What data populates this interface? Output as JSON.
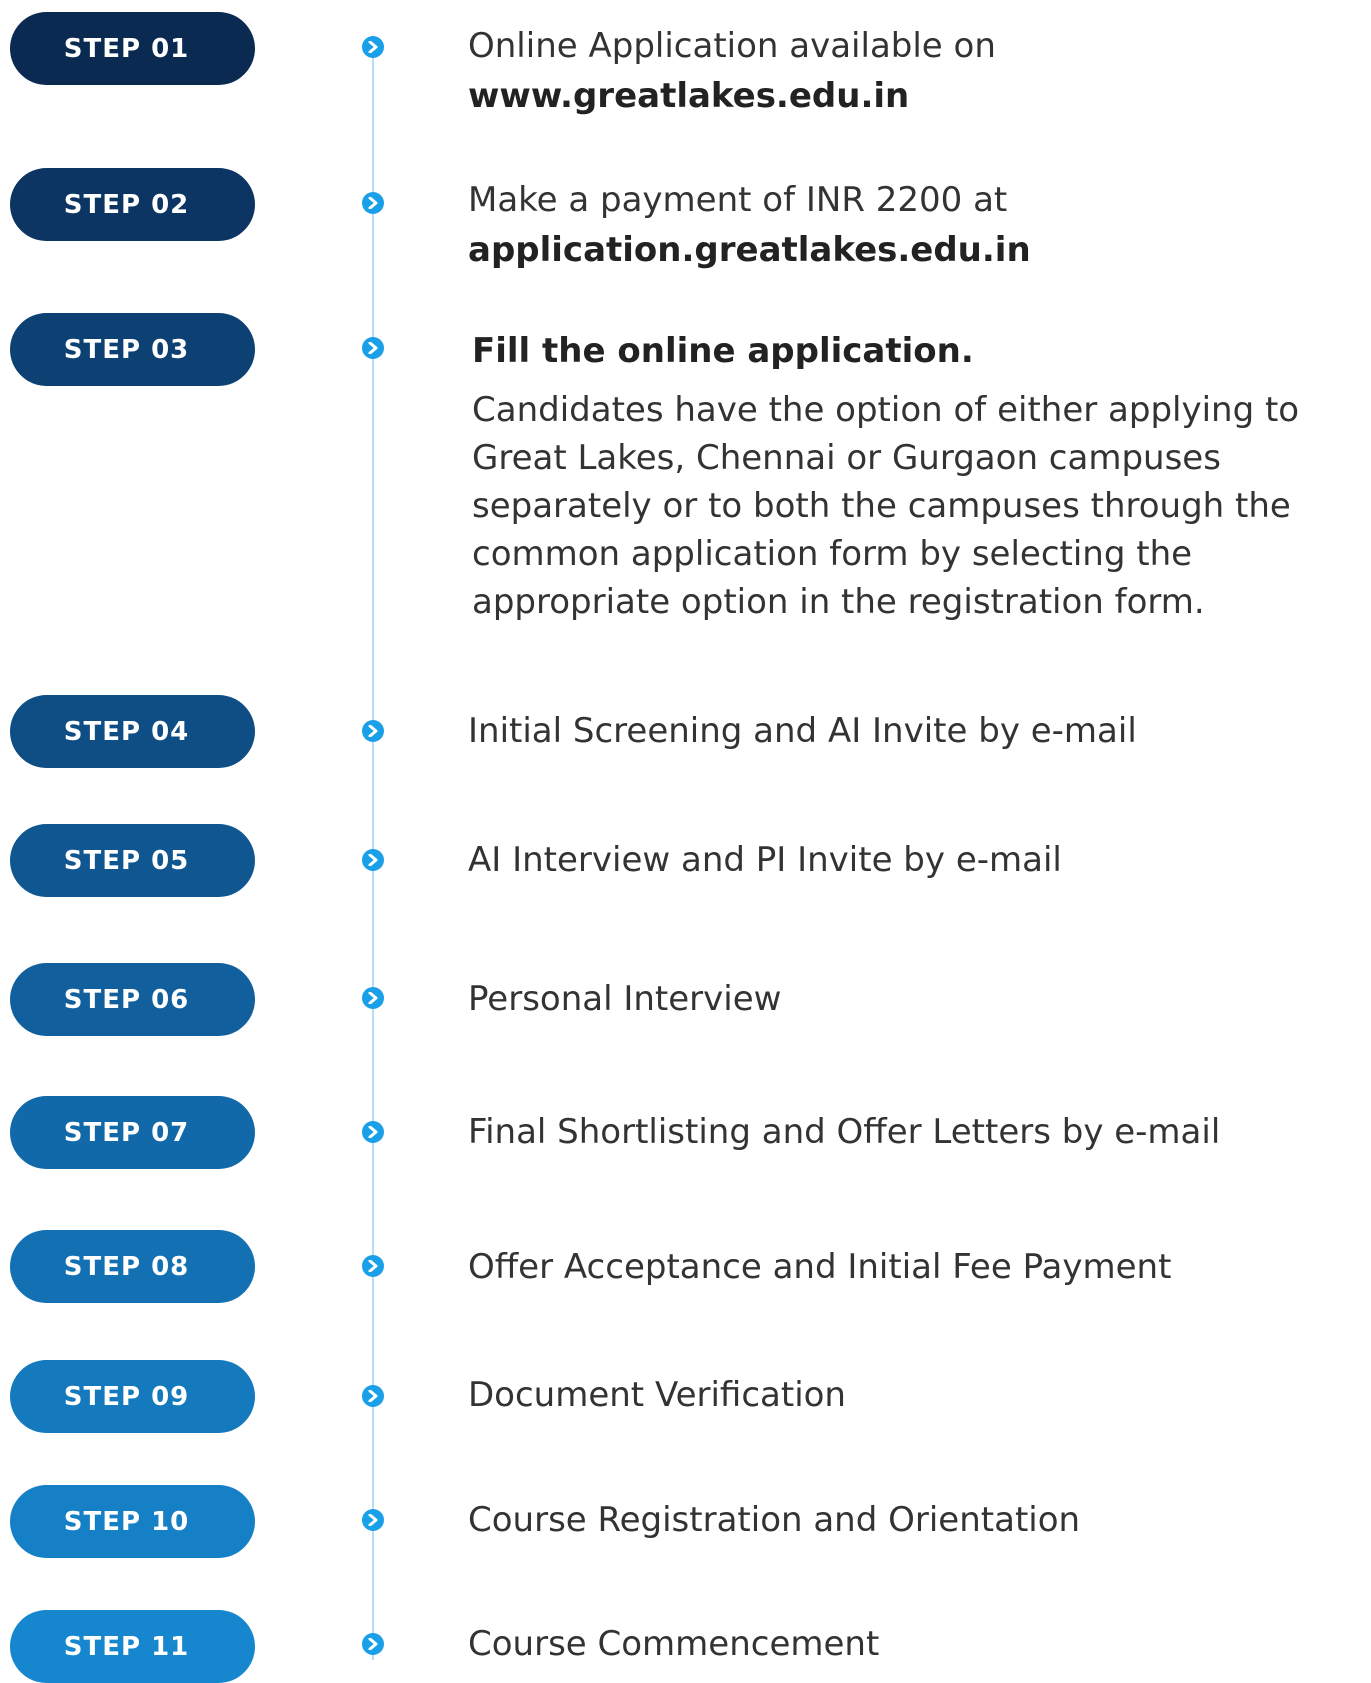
{
  "steps": [
    {
      "label": "STEP 01",
      "text": "Online Application available on",
      "link": "www.greatlakes.edu.in",
      "color": "#0a2a52"
    },
    {
      "label": "STEP 02",
      "text": "Make a payment of INR 2200 at",
      "link": "application.greatlakes.edu.in",
      "color": "#0c3563"
    },
    {
      "label": "STEP 03",
      "title": "Fill the online application.",
      "body": "Candidates have the option of either applying to\nGreat Lakes, Chennai or Gurgaon campuses\nseparately or to both the campuses through the\ncommon application form by selecting the\nappropriate option in the registration form.",
      "color": "#0e4173"
    },
    {
      "label": "STEP 04",
      "text": "Initial Screening and AI Invite by e-mail",
      "color": "#0f4d85"
    },
    {
      "label": "STEP 05",
      "text": "AI Interview and PI Invite by e-mail",
      "color": "#105791"
    },
    {
      "label": "STEP 06",
      "text": "Personal Interview",
      "color": "#11609d"
    },
    {
      "label": "STEP 07",
      "text": "Final Shortlisting and Offer Letters by e-mail",
      "color": "#1269a9"
    },
    {
      "label": "STEP 08",
      "text": "Offer Acceptance and Initial Fee Payment",
      "color": "#1371b3"
    },
    {
      "label": "STEP 09",
      "text": "Document Verification",
      "color": "#1479bd"
    },
    {
      "label": "STEP 10",
      "text": "Course Registration and Orientation",
      "color": "#1580c6"
    },
    {
      "label": "STEP 11",
      "text": "Course Commencement",
      "color": "#1687cf"
    }
  ]
}
